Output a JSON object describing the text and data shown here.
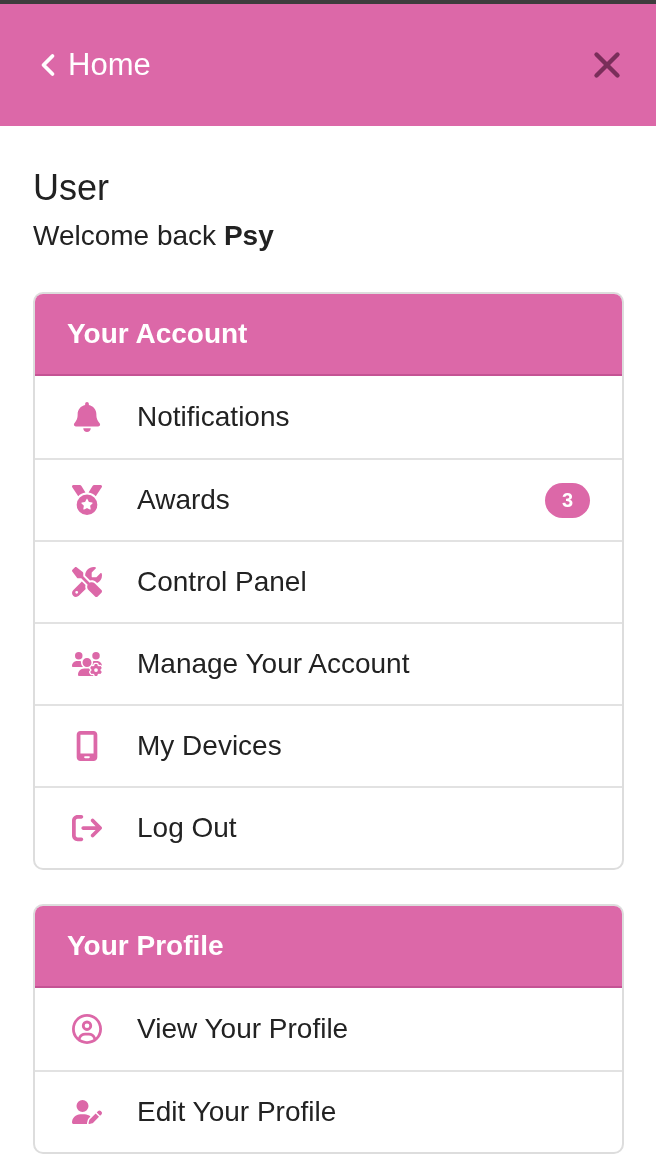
{
  "header": {
    "back_label": "Home"
  },
  "user": {
    "title": "User",
    "greeting": "Welcome back **Psy**"
  },
  "sections": [
    {
      "title": "Your Account",
      "items": [
        {
          "label": "Notifications"
        },
        {
          "label": "Awards",
          "badge": "3"
        },
        {
          "label": "Control Panel"
        },
        {
          "label": "Manage Your Account"
        },
        {
          "label": "My Devices"
        },
        {
          "label": "Log Out"
        }
      ]
    },
    {
      "title": "Your Profile",
      "items": [
        {
          "label": "View Your Profile"
        },
        {
          "label": "Edit Your Profile"
        }
      ]
    }
  ]
}
